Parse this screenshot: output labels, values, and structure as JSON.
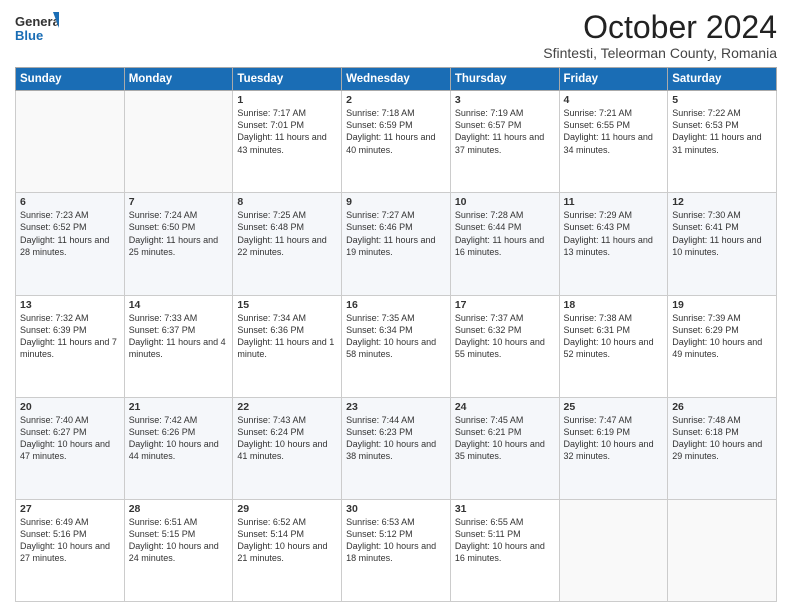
{
  "logo": {
    "line1": "General",
    "line2": "Blue"
  },
  "title": "October 2024",
  "subtitle": "Sfintesti, Teleorman County, Romania",
  "weekdays": [
    "Sunday",
    "Monday",
    "Tuesday",
    "Wednesday",
    "Thursday",
    "Friday",
    "Saturday"
  ],
  "weeks": [
    [
      {
        "day": "",
        "text": ""
      },
      {
        "day": "",
        "text": ""
      },
      {
        "day": "1",
        "text": "Sunrise: 7:17 AM\nSunset: 7:01 PM\nDaylight: 11 hours and 43 minutes."
      },
      {
        "day": "2",
        "text": "Sunrise: 7:18 AM\nSunset: 6:59 PM\nDaylight: 11 hours and 40 minutes."
      },
      {
        "day": "3",
        "text": "Sunrise: 7:19 AM\nSunset: 6:57 PM\nDaylight: 11 hours and 37 minutes."
      },
      {
        "day": "4",
        "text": "Sunrise: 7:21 AM\nSunset: 6:55 PM\nDaylight: 11 hours and 34 minutes."
      },
      {
        "day": "5",
        "text": "Sunrise: 7:22 AM\nSunset: 6:53 PM\nDaylight: 11 hours and 31 minutes."
      }
    ],
    [
      {
        "day": "6",
        "text": "Sunrise: 7:23 AM\nSunset: 6:52 PM\nDaylight: 11 hours and 28 minutes."
      },
      {
        "day": "7",
        "text": "Sunrise: 7:24 AM\nSunset: 6:50 PM\nDaylight: 11 hours and 25 minutes."
      },
      {
        "day": "8",
        "text": "Sunrise: 7:25 AM\nSunset: 6:48 PM\nDaylight: 11 hours and 22 minutes."
      },
      {
        "day": "9",
        "text": "Sunrise: 7:27 AM\nSunset: 6:46 PM\nDaylight: 11 hours and 19 minutes."
      },
      {
        "day": "10",
        "text": "Sunrise: 7:28 AM\nSunset: 6:44 PM\nDaylight: 11 hours and 16 minutes."
      },
      {
        "day": "11",
        "text": "Sunrise: 7:29 AM\nSunset: 6:43 PM\nDaylight: 11 hours and 13 minutes."
      },
      {
        "day": "12",
        "text": "Sunrise: 7:30 AM\nSunset: 6:41 PM\nDaylight: 11 hours and 10 minutes."
      }
    ],
    [
      {
        "day": "13",
        "text": "Sunrise: 7:32 AM\nSunset: 6:39 PM\nDaylight: 11 hours and 7 minutes."
      },
      {
        "day": "14",
        "text": "Sunrise: 7:33 AM\nSunset: 6:37 PM\nDaylight: 11 hours and 4 minutes."
      },
      {
        "day": "15",
        "text": "Sunrise: 7:34 AM\nSunset: 6:36 PM\nDaylight: 11 hours and 1 minute."
      },
      {
        "day": "16",
        "text": "Sunrise: 7:35 AM\nSunset: 6:34 PM\nDaylight: 10 hours and 58 minutes."
      },
      {
        "day": "17",
        "text": "Sunrise: 7:37 AM\nSunset: 6:32 PM\nDaylight: 10 hours and 55 minutes."
      },
      {
        "day": "18",
        "text": "Sunrise: 7:38 AM\nSunset: 6:31 PM\nDaylight: 10 hours and 52 minutes."
      },
      {
        "day": "19",
        "text": "Sunrise: 7:39 AM\nSunset: 6:29 PM\nDaylight: 10 hours and 49 minutes."
      }
    ],
    [
      {
        "day": "20",
        "text": "Sunrise: 7:40 AM\nSunset: 6:27 PM\nDaylight: 10 hours and 47 minutes."
      },
      {
        "day": "21",
        "text": "Sunrise: 7:42 AM\nSunset: 6:26 PM\nDaylight: 10 hours and 44 minutes."
      },
      {
        "day": "22",
        "text": "Sunrise: 7:43 AM\nSunset: 6:24 PM\nDaylight: 10 hours and 41 minutes."
      },
      {
        "day": "23",
        "text": "Sunrise: 7:44 AM\nSunset: 6:23 PM\nDaylight: 10 hours and 38 minutes."
      },
      {
        "day": "24",
        "text": "Sunrise: 7:45 AM\nSunset: 6:21 PM\nDaylight: 10 hours and 35 minutes."
      },
      {
        "day": "25",
        "text": "Sunrise: 7:47 AM\nSunset: 6:19 PM\nDaylight: 10 hours and 32 minutes."
      },
      {
        "day": "26",
        "text": "Sunrise: 7:48 AM\nSunset: 6:18 PM\nDaylight: 10 hours and 29 minutes."
      }
    ],
    [
      {
        "day": "27",
        "text": "Sunrise: 6:49 AM\nSunset: 5:16 PM\nDaylight: 10 hours and 27 minutes."
      },
      {
        "day": "28",
        "text": "Sunrise: 6:51 AM\nSunset: 5:15 PM\nDaylight: 10 hours and 24 minutes."
      },
      {
        "day": "29",
        "text": "Sunrise: 6:52 AM\nSunset: 5:14 PM\nDaylight: 10 hours and 21 minutes."
      },
      {
        "day": "30",
        "text": "Sunrise: 6:53 AM\nSunset: 5:12 PM\nDaylight: 10 hours and 18 minutes."
      },
      {
        "day": "31",
        "text": "Sunrise: 6:55 AM\nSunset: 5:11 PM\nDaylight: 10 hours and 16 minutes."
      },
      {
        "day": "",
        "text": ""
      },
      {
        "day": "",
        "text": ""
      }
    ]
  ]
}
